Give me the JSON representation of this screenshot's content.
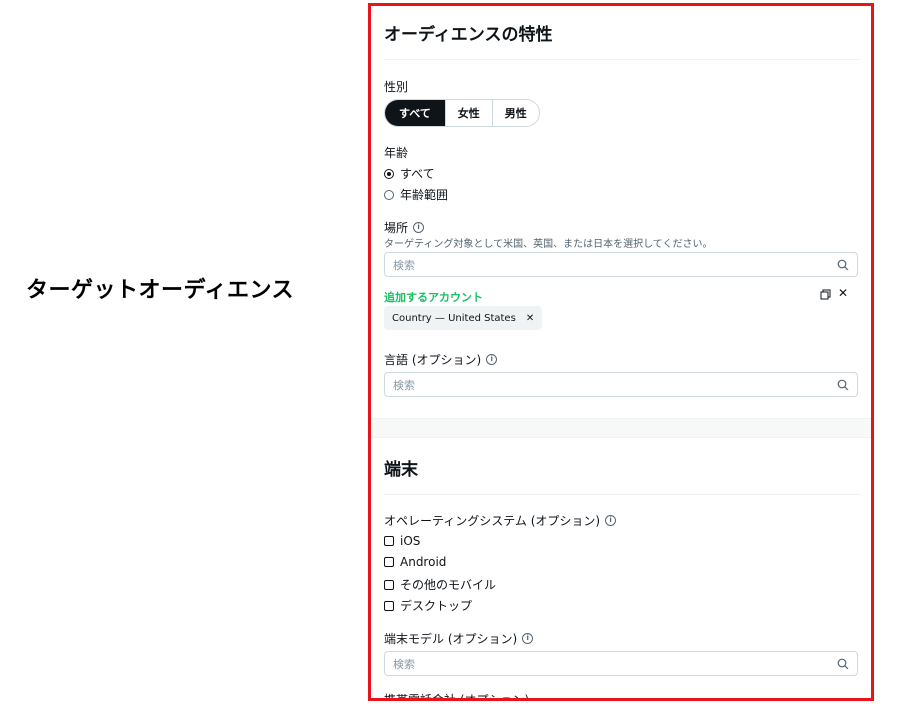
{
  "side_title": "ターゲットオーディエンス",
  "audience": {
    "heading": "オーディエンスの特性",
    "gender": {
      "label": "性別",
      "options": [
        "すべて",
        "女性",
        "男性"
      ],
      "selected": "すべて"
    },
    "age": {
      "label": "年齢",
      "options": [
        "すべて",
        "年齢範囲"
      ],
      "selected": "すべて"
    },
    "location": {
      "label": "場所",
      "helper": "ターゲティング対象として米国、英国、または日本を選択してください。",
      "placeholder": "検索",
      "added_label": "追加するアカウント",
      "chip": "Country — United States"
    },
    "language": {
      "label": "言語 (オプション)",
      "placeholder": "検索"
    }
  },
  "device": {
    "heading": "端末",
    "os": {
      "label": "オペレーティングシステム (オプション)",
      "options": [
        "iOS",
        "Android",
        "その他のモバイル",
        "デスクトップ"
      ]
    },
    "model": {
      "label": "端末モデル (オプション)",
      "placeholder": "検索"
    },
    "next_partial": "携帯電話会社 (オプション)"
  },
  "colors": {
    "accent_green": "#17bf63",
    "highlight_border": "#e8141b",
    "selected_segment": "#0f1419"
  },
  "icons": [
    "info-icon",
    "search-icon",
    "copy-icon",
    "close-icon"
  ]
}
